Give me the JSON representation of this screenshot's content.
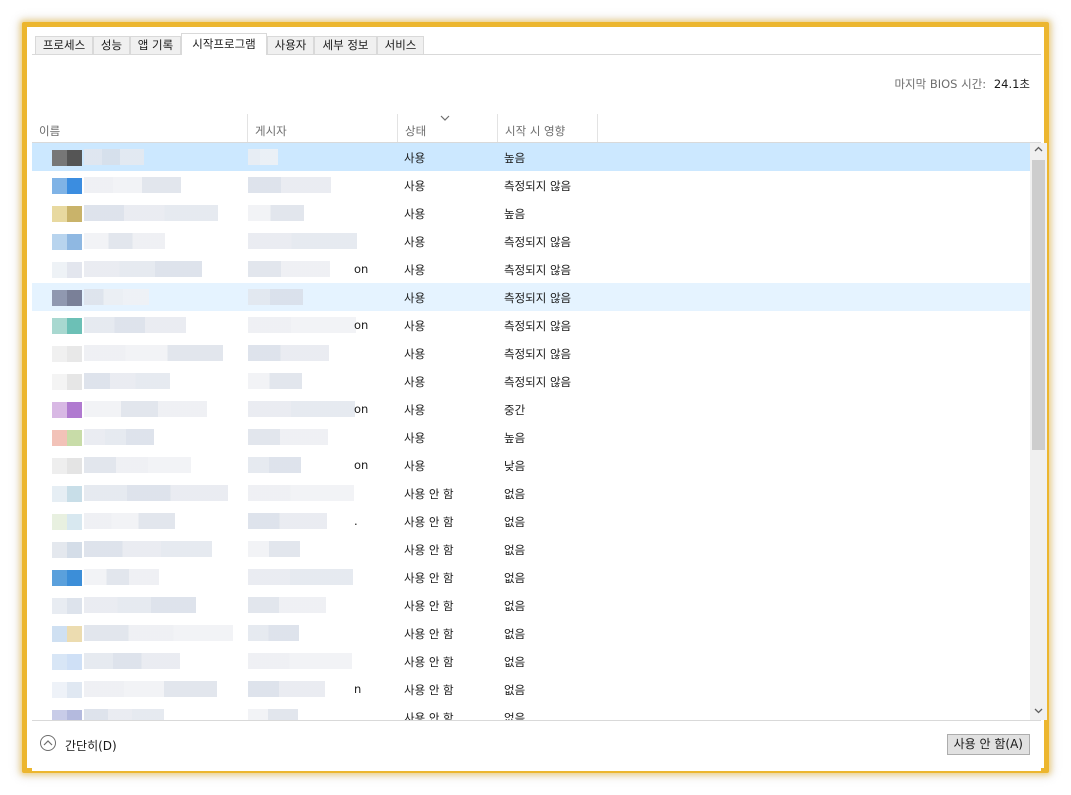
{
  "tabs": [
    {
      "label": "프로세스",
      "active": false
    },
    {
      "label": "성능",
      "active": false
    },
    {
      "label": "앱 기록",
      "active": false
    },
    {
      "label": "시작프로그램",
      "active": true
    },
    {
      "label": "사용자",
      "active": false
    },
    {
      "label": "세부 정보",
      "active": false
    },
    {
      "label": "서비스",
      "active": false
    }
  ],
  "bios": {
    "label": "마지막 BIOS 시간:",
    "value": "24.1초"
  },
  "columns": {
    "name": "이름",
    "publisher": "게시자",
    "status": "상태",
    "impact": "시작 시 영향",
    "sort_icon": "chevron-down-icon"
  },
  "rows": [
    {
      "status": "사용",
      "impact": "높음",
      "suffix": "",
      "state": "selected",
      "icon_colors": [
        "#777777",
        "#555555"
      ]
    },
    {
      "status": "사용",
      "impact": "측정되지 않음",
      "suffix": "",
      "state": "",
      "icon_colors": [
        "#7fb3e6",
        "#3b8de0"
      ]
    },
    {
      "status": "사용",
      "impact": "높음",
      "suffix": "",
      "state": "",
      "icon_colors": [
        "#e8d9a0",
        "#c9b36a"
      ]
    },
    {
      "status": "사용",
      "impact": "측정되지 않음",
      "suffix": "",
      "state": "",
      "icon_colors": [
        "#b8d4ee",
        "#8fb8e2"
      ]
    },
    {
      "status": "사용",
      "impact": "측정되지 않음",
      "suffix": "on",
      "state": "",
      "icon_colors": [
        "#eef2f6",
        "#e3e6ee"
      ]
    },
    {
      "status": "사용",
      "impact": "측정되지 않음",
      "suffix": "",
      "state": "hover",
      "icon_colors": [
        "#9098b0",
        "#7a8098"
      ]
    },
    {
      "status": "사용",
      "impact": "측정되지 않음",
      "suffix": "on",
      "state": "",
      "icon_colors": [
        "#a8d8d0",
        "#6cc0b6"
      ]
    },
    {
      "status": "사용",
      "impact": "측정되지 않음",
      "suffix": "",
      "state": "",
      "icon_colors": [
        "#f0f0f0",
        "#e8e8e8"
      ]
    },
    {
      "status": "사용",
      "impact": "측정되지 않음",
      "suffix": "",
      "state": "",
      "icon_colors": [
        "#f4f4f4",
        "#e6e6e6"
      ]
    },
    {
      "status": "사용",
      "impact": "중간",
      "suffix": "on",
      "state": "",
      "icon_colors": [
        "#d8b8e4",
        "#b07ad0"
      ]
    },
    {
      "status": "사용",
      "impact": "높음",
      "suffix": "",
      "state": "",
      "icon_colors": [
        "#f2c2b8",
        "#c8dca8"
      ]
    },
    {
      "status": "사용",
      "impact": "낮음",
      "suffix": "on",
      "state": "",
      "icon_colors": [
        "#eeeeee",
        "#e4e4e4"
      ]
    },
    {
      "status": "사용 안 함",
      "impact": "없음",
      "suffix": "",
      "state": "",
      "icon_colors": [
        "#e6eef4",
        "#c8dee8"
      ]
    },
    {
      "status": "사용 안 함",
      "impact": "없음",
      "suffix": ".",
      "state": "",
      "icon_colors": [
        "#e8f0e0",
        "#d8e8f0"
      ]
    },
    {
      "status": "사용 안 함",
      "impact": "없음",
      "suffix": "",
      "state": "",
      "icon_colors": [
        "#e4e8ee",
        "#d4dde8"
      ]
    },
    {
      "status": "사용 안 함",
      "impact": "없음",
      "suffix": "",
      "state": "",
      "icon_colors": [
        "#5aa0dc",
        "#3c8ed8"
      ]
    },
    {
      "status": "사용 안 함",
      "impact": "없음",
      "suffix": "",
      "state": "",
      "icon_colors": [
        "#e8ecf2",
        "#dde3ec"
      ]
    },
    {
      "status": "사용 안 함",
      "impact": "없음",
      "suffix": "",
      "state": "",
      "icon_colors": [
        "#cfe0f2",
        "#ecdcb0"
      ]
    },
    {
      "status": "사용 안 함",
      "impact": "없음",
      "suffix": "",
      "state": "",
      "icon_colors": [
        "#d8e6f6",
        "#cfe0f6"
      ]
    },
    {
      "status": "사용 안 함",
      "impact": "없음",
      "suffix": "n",
      "state": "",
      "icon_colors": [
        "#eef2f8",
        "#e0e8f2"
      ]
    },
    {
      "status": "사용 안 함",
      "impact": "없음",
      "suffix": "",
      "state": "",
      "icon_colors": [
        "#c8cce8",
        "#b4bade"
      ]
    }
  ],
  "footer": {
    "fewer_label": "간단히(D)",
    "fewer_icon": "chevron-up-circle-icon",
    "disable_label": "사용 안 함(A)"
  },
  "scrollbar": {
    "up_icon": "scroll-up-arrow-icon",
    "down_icon": "scroll-down-arrow-icon"
  },
  "colors": {
    "frame": "#ecb62f",
    "selected_row": "#cce8ff",
    "hover_row": "#e5f3ff"
  }
}
